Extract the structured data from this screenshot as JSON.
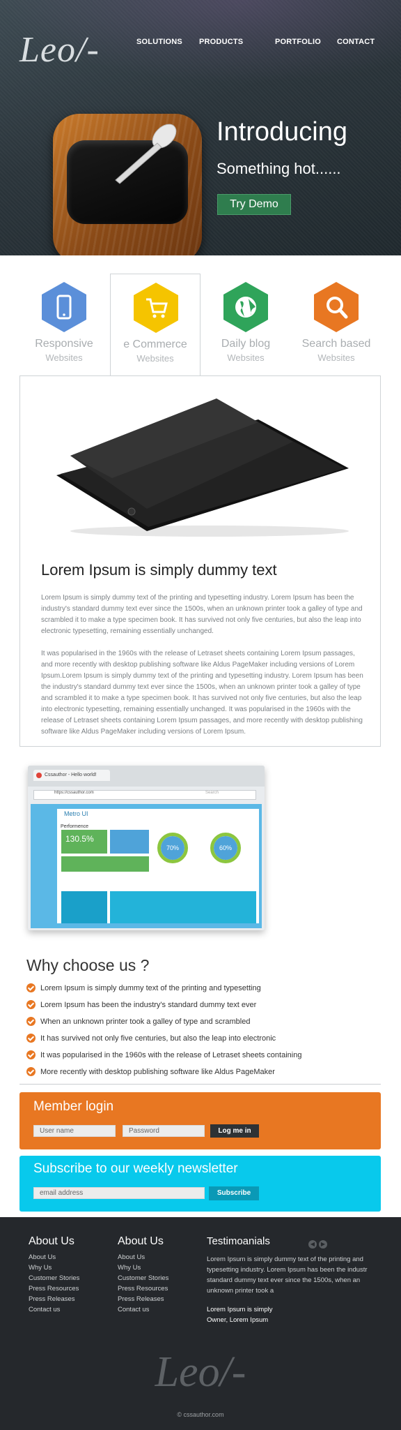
{
  "header": {
    "logo": "Leo/-",
    "nav": [
      "SOLUTIONS",
      "PRODUCTS",
      "PORTFOLIO",
      "CONTACT"
    ]
  },
  "hero": {
    "title": "Introducing",
    "subtitle": "Something hot......",
    "cta": "Try Demo"
  },
  "features": [
    {
      "title": "Responsive",
      "sub": "Websites",
      "color": "#5b8fd9",
      "icon": "phone-icon"
    },
    {
      "title": "e Commerce",
      "sub": "Websites",
      "color": "#f5c400",
      "icon": "cart-icon"
    },
    {
      "title": "Daily blog",
      "sub": "Websites",
      "color": "#2fa45a",
      "icon": "globe-icon"
    },
    {
      "title": "Search based",
      "sub": "Websites",
      "color": "#e87722",
      "icon": "search-icon"
    }
  ],
  "content": {
    "heading": "Lorem Ipsum is simply dummy text",
    "p1": "Lorem Ipsum is simply dummy text of the printing and typesetting industry. Lorem Ipsum has been the industry's standard dummy text ever since the 1500s, when an unknown printer took a galley of type and scrambled it to make a type specimen book. It has survived not only five centuries, but also the leap into electronic typesetting, remaining essentially unchanged.",
    "p2": "It was popularised in the 1960s with the release of Letraset sheets containing Lorem Ipsum passages, and more recently with desktop publishing software like Aldus PageMaker including versions of Lorem Ipsum.Lorem Ipsum is simply dummy text of the printing and typesetting industry. Lorem Ipsum has been the industry's standard dummy text ever since the 1500s, when an unknown printer took a galley of type and scrambled it to make a type specimen book. It has survived not only five centuries, but also the leap into electronic typesetting, remaining essentially unchanged. It was popularised in the 1960s with the release of Letraset sheets containing Lorem Ipsum passages, and more recently with desktop publishing software like Aldus PageMaker including versions of Lorem Ipsum."
  },
  "screenshot": {
    "tab": "Cssauthor - Hello world!",
    "url": "https://cssauthor.com",
    "search": "Search",
    "app_title": "Metro UI",
    "section": "Performence",
    "stat": "130.5%",
    "ring1": "70%",
    "ring2": "60%"
  },
  "why": {
    "heading": "Why choose us ?",
    "items": [
      "Lorem Ipsum is simply dummy text of the printing and typesetting",
      "Lorem Ipsum has been the industry's standard dummy text ever",
      "When an unknown printer took a galley of type and scrambled",
      "It has survived not only five centuries, but also the leap into electronic",
      "It was popularised in the 1960s with the release of Letraset sheets containing",
      "More recently with desktop publishing software like Aldus PageMaker"
    ]
  },
  "member": {
    "heading": "Member login",
    "user_placeholder": "User name",
    "pass_placeholder": "Password",
    "button": "Log me in"
  },
  "newsletter": {
    "heading": "Subscribe to our weekly newsletter",
    "placeholder": "email address",
    "button": "Subscribe"
  },
  "footer": {
    "col1": {
      "heading": "About Us",
      "links": [
        "About Us",
        "Why Us",
        "Customer Stories",
        "Press Resources",
        "Press Releases",
        "Contact us"
      ]
    },
    "col2": {
      "heading": "About Us",
      "links": [
        "About Us",
        "Why Us",
        "Customer Stories",
        "Press Resources",
        "Press Releases",
        "Contact us"
      ]
    },
    "testimonials": {
      "heading": "Testimoanials",
      "text": "Lorem Ipsum is simply dummy text of the printing and typesetting industry. Lorem Ipsum has been the industr standard dummy text ever since the 1500s, when an unknown printer took a",
      "author_line1": "Lorem Ipsum is simply",
      "author_line2": "Owner, Lorem Ipsum"
    },
    "logo": "Leo/-",
    "copyright": "© cssauthor.com"
  }
}
